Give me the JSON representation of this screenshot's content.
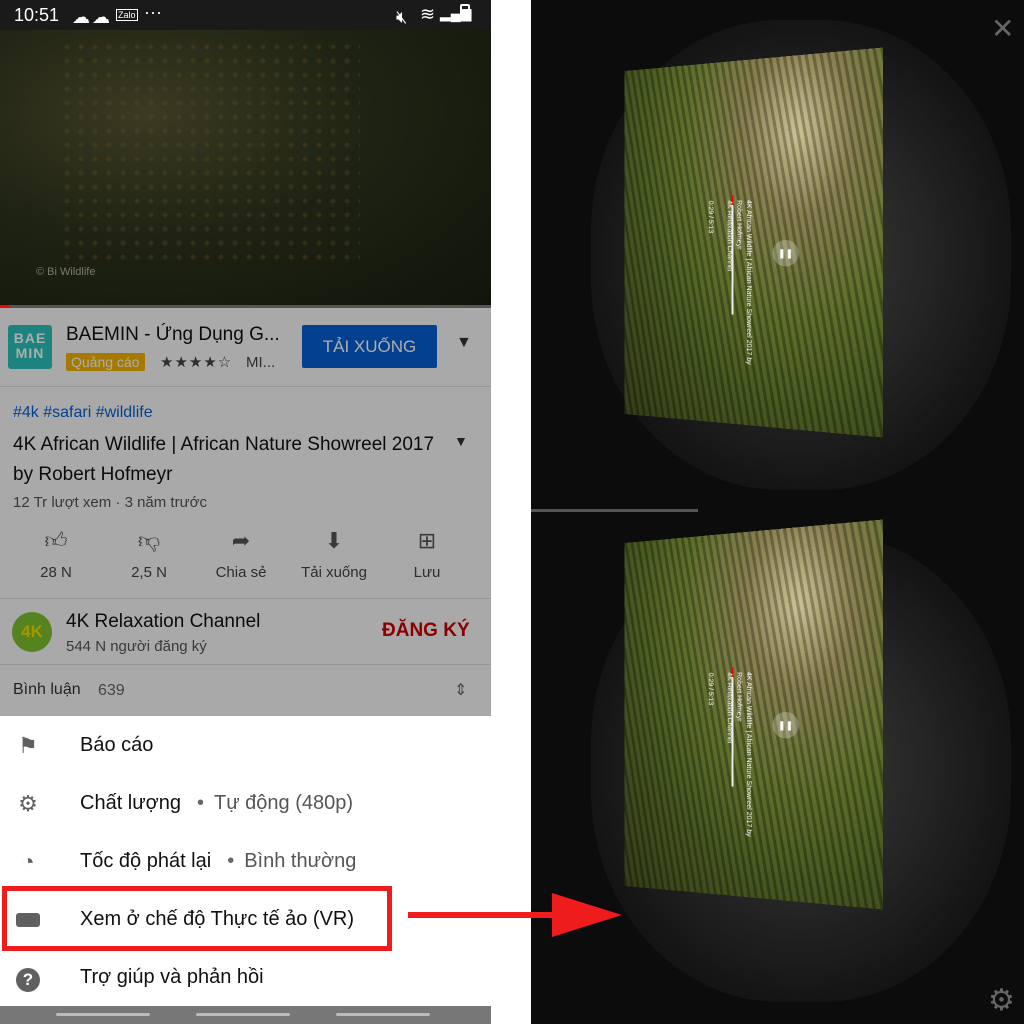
{
  "status_bar": {
    "time": "10:51",
    "app_label": "Zalo"
  },
  "video": {
    "progress": 0.02,
    "watermark": "© Bi Wildlife"
  },
  "ad": {
    "logo_line1": "BAE",
    "logo_line2": "MIN",
    "title": "BAEMIN - Ứng Dụng G...",
    "badge": "Quảng cáo",
    "stars": "★★★★☆",
    "more": "MI...",
    "button": "TẢI XUỐNG"
  },
  "video_info": {
    "hashtags": "#4k #safari #wildlife",
    "title": "4K African Wildlife | African Nature Showreel 2017 by Robert Hofmeyr",
    "meta": "12 Tr lượt xem · 3 năm trước"
  },
  "actions": [
    {
      "icon": "thumbs-up-icon",
      "label": "28 N"
    },
    {
      "icon": "thumbs-down-icon",
      "label": "2,5 N"
    },
    {
      "icon": "share-icon",
      "label": "Chia sẻ"
    },
    {
      "icon": "download-icon",
      "label": "Tải xuống"
    },
    {
      "icon": "save-playlist-icon",
      "label": "Lưu"
    }
  ],
  "channel": {
    "logo": "4K",
    "name": "4K Relaxation Channel",
    "subs": "544 N người đăng ký",
    "subscribe": "ĐĂNG KÝ"
  },
  "comments": {
    "label": "Bình luận",
    "count": "639"
  },
  "menu": [
    {
      "icon": "flag-icon",
      "label": "Báo cáo",
      "value": ""
    },
    {
      "icon": "gear-icon",
      "label": "Chất lượng",
      "value": "Tự động (480p)"
    },
    {
      "icon": "playback-speed-icon",
      "label": "Tốc độ phát lại",
      "value": "Bình thường"
    },
    {
      "icon": "vr-headset-icon",
      "label": "Xem ở chế độ Thực tế ảo (VR)",
      "value": ""
    },
    {
      "icon": "help-icon",
      "label": "Trợ giúp và phản hồi",
      "value": ""
    }
  ],
  "vr_overlay": {
    "video_title": "4K African Wildlife | African Nature Showreel 2017 by Robert Hofmeyr",
    "channel": "4K Relaxation Channel",
    "time": "0:29 / 5:13"
  },
  "colors": {
    "accent_red": "#ee1c1c",
    "youtube_blue": "#065fd4",
    "subscribe_red": "#cc0000",
    "ad_badge": "#f5b400"
  }
}
